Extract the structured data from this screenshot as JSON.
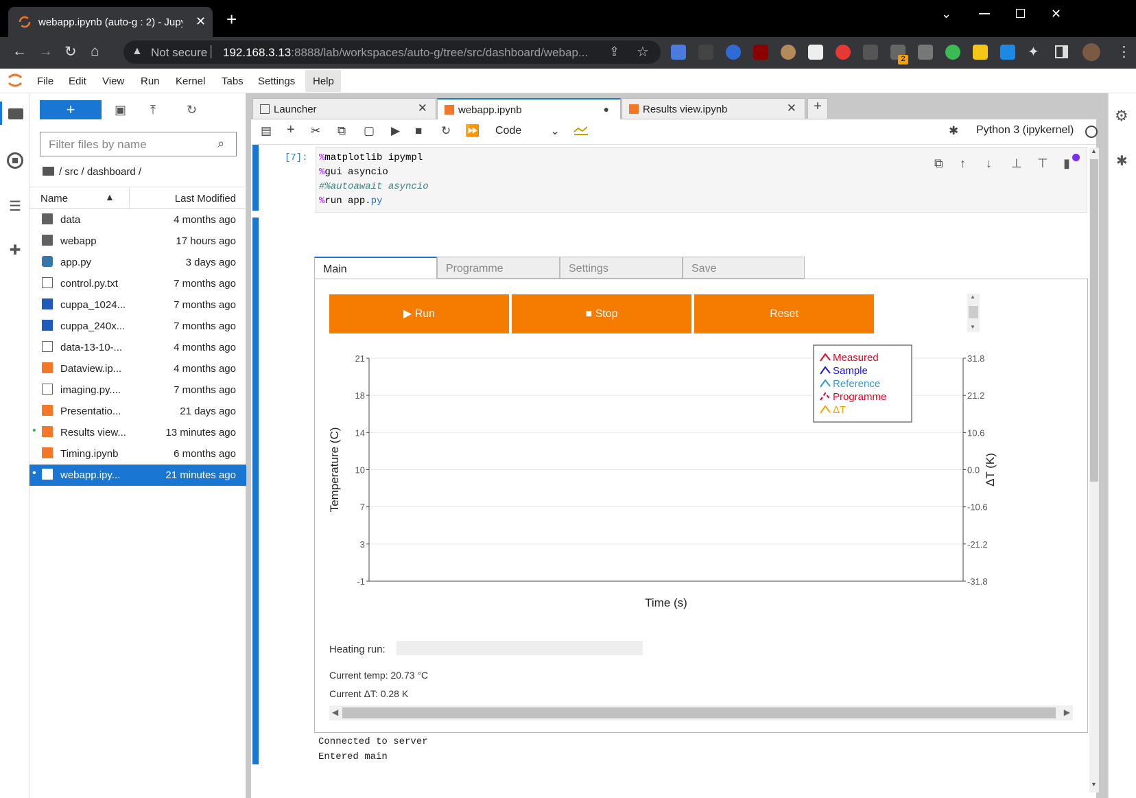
{
  "browser": {
    "tab_title": "webapp.ipynb (auto-g : 2) - Jupyt",
    "not_secure": "Not secure",
    "url_host": "192.168.3.13",
    "url_rest": ":8888/lab/workspaces/auto-g/tree/src/dashboard/webap...",
    "ext_badge": "2"
  },
  "menu": [
    "File",
    "Edit",
    "View",
    "Run",
    "Kernel",
    "Tabs",
    "Settings",
    "Help"
  ],
  "filebrowser": {
    "new_label": "+",
    "filter_placeholder": "Filter files by name",
    "breadcrumb": "/ src / dashboard /",
    "col_name": "Name",
    "col_modified": "Last Modified",
    "files": [
      {
        "name": "data",
        "modified": "4 months ago",
        "type": "folder"
      },
      {
        "name": "webapp",
        "modified": "17 hours ago",
        "type": "folder"
      },
      {
        "name": "app.py",
        "modified": "3 days ago",
        "type": "py"
      },
      {
        "name": "control.py.txt",
        "modified": "7 months ago",
        "type": "file"
      },
      {
        "name": "cuppa_1024...",
        "modified": "7 months ago",
        "type": "img"
      },
      {
        "name": "cuppa_240x...",
        "modified": "7 months ago",
        "type": "img"
      },
      {
        "name": "data-13-10-...",
        "modified": "4 months ago",
        "type": "file"
      },
      {
        "name": "Dataview.ip...",
        "modified": "4 months ago",
        "type": "nb"
      },
      {
        "name": "imaging.py....",
        "modified": "7 months ago",
        "type": "file"
      },
      {
        "name": "Presentatio...",
        "modified": "21 days ago",
        "type": "nb"
      },
      {
        "name": "Results view...",
        "modified": "13 minutes ago",
        "type": "nb",
        "running": true
      },
      {
        "name": "Timing.ipynb",
        "modified": "6 months ago",
        "type": "nb"
      },
      {
        "name": "webapp.ipy...",
        "modified": "21 minutes ago",
        "type": "nb",
        "running": true,
        "selected": true
      }
    ]
  },
  "tabs": [
    {
      "label": "Launcher"
    },
    {
      "label": "webapp.ipynb"
    },
    {
      "label": "Results view.ipynb"
    }
  ],
  "toolbar": {
    "cell_type": "Code",
    "kernel": "Python 3 (ipykernel)"
  },
  "cell": {
    "prompt": "[7]:",
    "lines": [
      {
        "magic": "%",
        "rest": "matplotlib ipympl"
      },
      {
        "magic": "%",
        "rest": "gui asyncio"
      },
      {
        "comment": "#%autoawait asyncio"
      },
      {
        "magic": "%",
        "rest": "run app.",
        "ext": "py"
      }
    ]
  },
  "widget": {
    "tabs": [
      "Main",
      "Programme",
      "Settings",
      "Save"
    ],
    "buttons": {
      "run": "Run",
      "stop": "Stop",
      "reset": "Reset"
    },
    "heating_label": "Heating run:",
    "heating_progress": 0,
    "current_temp": "Current temp: 20.73 °C",
    "current_dt": "Current ΔT: 0.28 K"
  },
  "chart_data": {
    "type": "line",
    "xlabel": "Time (s)",
    "ylabel": "Temperature (C)",
    "y2label": "ΔT (K)",
    "ylim": [
      -1,
      21
    ],
    "y2lim": [
      -31.8,
      31.8
    ],
    "yticks": [
      "21",
      "18",
      "14",
      "10",
      "7",
      "3",
      "-1"
    ],
    "y2ticks": [
      "31.8",
      "21.2",
      "10.6",
      "0.0",
      "-10.6",
      "-21.2",
      "-31.8"
    ],
    "series": [
      {
        "name": "Measured",
        "color": "#e8001c",
        "values": []
      },
      {
        "name": "Sample",
        "color": "#1a1adf",
        "values": []
      },
      {
        "name": "Reference",
        "color": "#2e9bd6",
        "values": []
      },
      {
        "name": "Programme",
        "color": "#e8001c",
        "dashed": true,
        "values": []
      },
      {
        "name": "ΔT",
        "color": "#f5a200",
        "values": []
      }
    ],
    "legend_position": "top-right",
    "grid": true
  },
  "output_stream": [
    "Connected to server",
    "Entered main"
  ]
}
